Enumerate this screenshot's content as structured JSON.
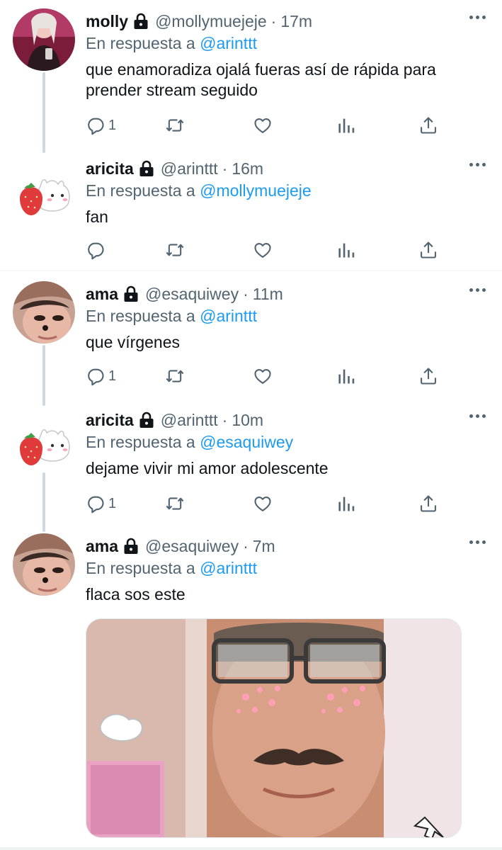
{
  "reply_prefix": "En respuesta a",
  "tweets": [
    {
      "name": "molly",
      "handle": "@mollymuejeje",
      "time": "17m",
      "reply_to": "@arinttt",
      "text": "que enamoradiza ojalá fueras así de rápida para prender stream seguido",
      "reply_count": "1"
    },
    {
      "name": "aricita",
      "handle": "@arinttt",
      "time": "16m",
      "reply_to": "@mollymuejeje",
      "text": "fan",
      "reply_count": ""
    },
    {
      "name": "ama",
      "handle": "@esaquiwey",
      "time": "11m",
      "reply_to": "@arinttt",
      "text": "que vírgenes",
      "reply_count": "1"
    },
    {
      "name": "aricita",
      "handle": "@arinttt",
      "time": "10m",
      "reply_to": "@esaquiwey",
      "text": "dejame vivir mi amor adolescente",
      "reply_count": "1"
    },
    {
      "name": "ama",
      "handle": "@esaquiwey",
      "time": "7m",
      "reply_to": "@arinttt",
      "text": "flaca sos este"
    }
  ],
  "colors": {
    "accent": "#1d9bf0",
    "secondary_text": "#536471",
    "thread_line": "#cfd9de"
  },
  "icons": [
    "lock-icon",
    "more-icon",
    "reply-icon",
    "retweet-icon",
    "like-icon",
    "views-icon",
    "share-icon"
  ]
}
